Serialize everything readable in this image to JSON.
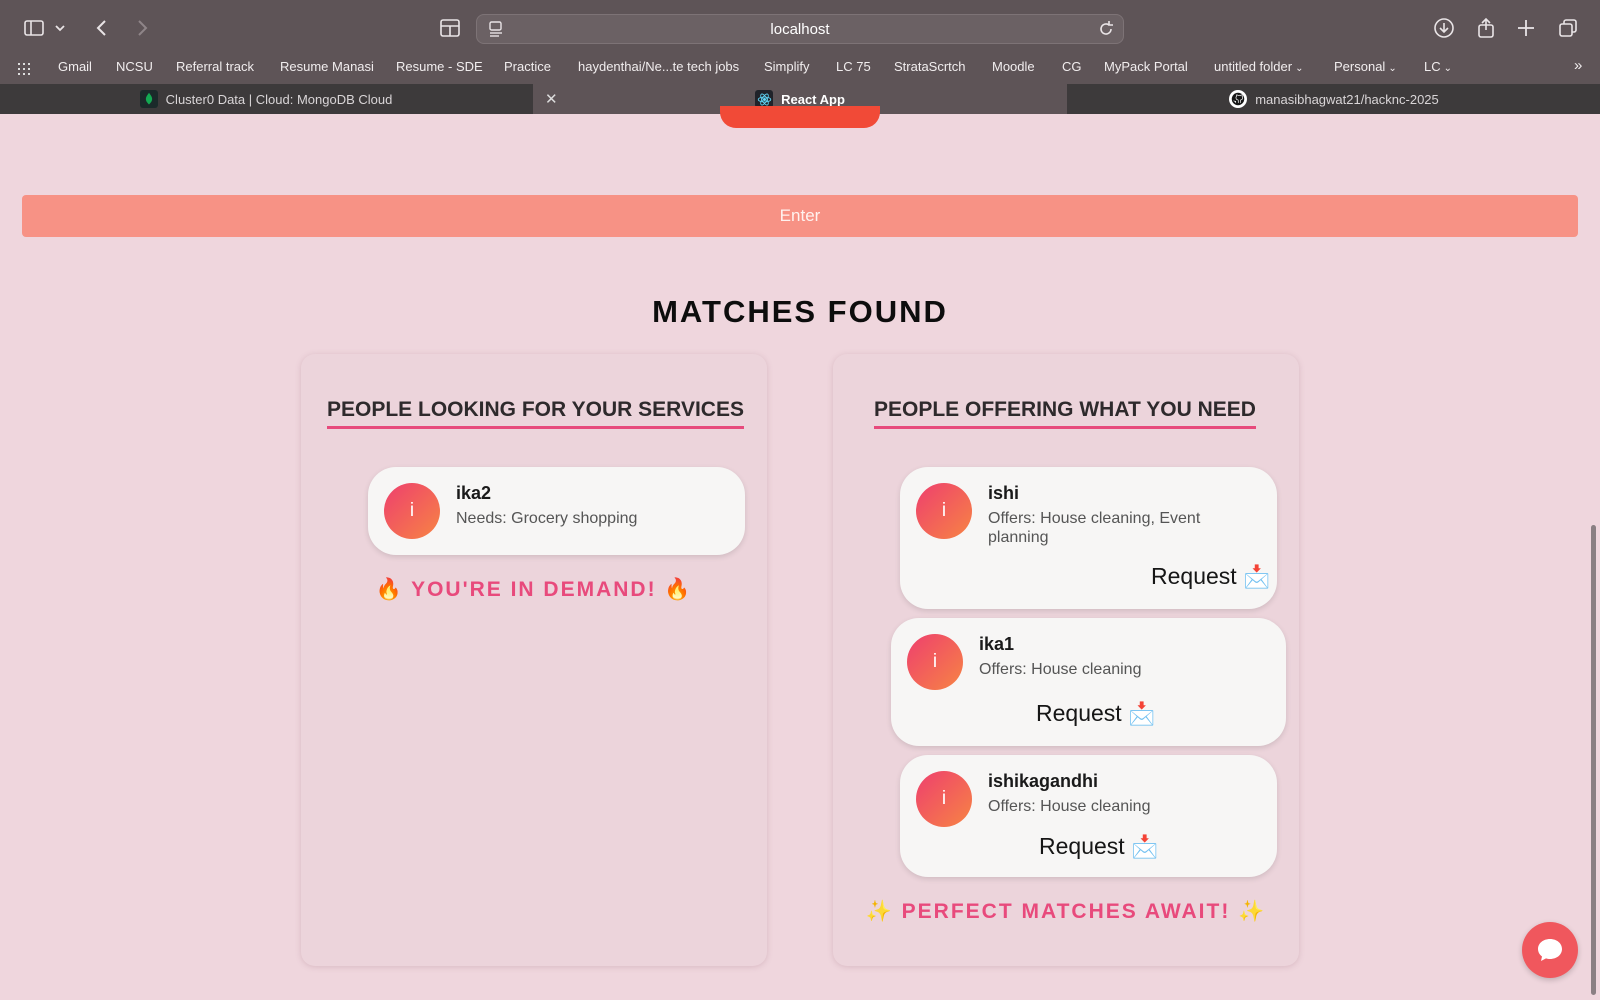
{
  "browser": {
    "url": "localhost",
    "bookmarks": [
      "Gmail",
      "NCSU",
      "Referral track",
      "Resume Manasi",
      "Resume - SDE",
      "Practice",
      "haydenthai/Ne...te tech jobs",
      "Simplify",
      "LC 75",
      "StrataScrtch",
      "Moodle",
      "CG",
      "MyPack Portal",
      "untitled folder",
      "Personal",
      "LC"
    ],
    "tabs": [
      "Cluster0 Data | Cloud: MongoDB Cloud",
      "React App",
      "manasibhagwat21/hacknc-2025"
    ]
  },
  "page": {
    "enter_label": "Enter",
    "matches_title": "MATCHES FOUND",
    "left_panel": {
      "heading": "PEOPLE LOOKING FOR YOUR SERVICES",
      "cards": [
        {
          "avatar": "i",
          "name": "ika2",
          "desc": "Needs: Grocery shopping"
        }
      ],
      "footer": "YOU'RE IN DEMAND!",
      "footer_emoji": "🔥"
    },
    "right_panel": {
      "heading": "PEOPLE OFFERING WHAT YOU NEED",
      "cards": [
        {
          "avatar": "i",
          "name": "ishi",
          "desc": "Offers: House cleaning, Event planning",
          "action": "Request"
        },
        {
          "avatar": "i",
          "name": "ika1",
          "desc": "Offers: House cleaning",
          "action": "Request"
        },
        {
          "avatar": "i",
          "name": "ishikagandhi",
          "desc": "Offers: House cleaning",
          "action": "Request"
        }
      ],
      "footer": "PERFECT MATCHES AWAIT!",
      "footer_emoji": "✨"
    },
    "action_emoji": "📩"
  },
  "colors": {
    "page_bg": "#efd6dd",
    "accent_pink": "#e84a7c",
    "enter_bg": "#f79285",
    "chat_button": "#f0575d"
  }
}
